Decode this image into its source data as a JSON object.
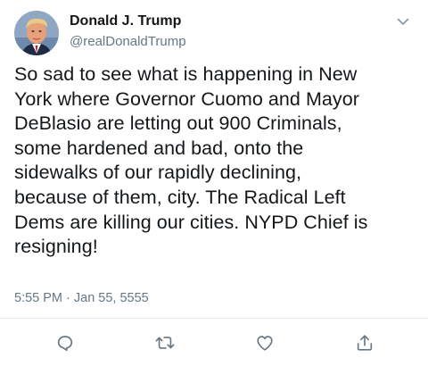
{
  "tweet": {
    "author": {
      "display_name": "Donald J. Trump",
      "handle": "@realDonaldTrump",
      "avatar_icon": "profile-photo"
    },
    "text": "So sad to see what is happening in New\nYork where Governor Cuomo and Mayor\nDeBlasio are letting out 900 Criminals,\nsome hardened and bad, onto the\nsidewalks of our rapidly declining,\nbecause of them, city. The Radical Left\nDems are killing our cities. NYPD Chief is\nresigning!",
    "timestamp": "5:55 PM · Jan 55, 5555",
    "menu_icon": "chevron-down-icon",
    "actions": [
      {
        "name": "reply",
        "icon": "reply-icon"
      },
      {
        "name": "retweet",
        "icon": "retweet-icon"
      },
      {
        "name": "like",
        "icon": "heart-icon"
      },
      {
        "name": "share",
        "icon": "share-icon"
      }
    ]
  },
  "colors": {
    "text_primary": "#14171a",
    "text_secondary": "#657786",
    "icon": "#657786",
    "divider": "#e6ecf0"
  }
}
